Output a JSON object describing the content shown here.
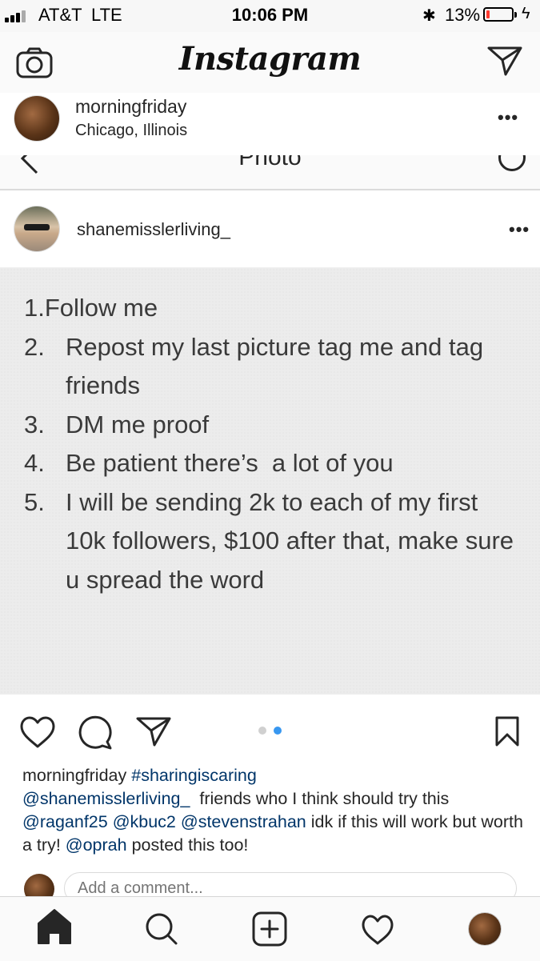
{
  "status_bar": {
    "carrier": "AT&T",
    "network": "LTE",
    "time": "10:06 PM",
    "battery_percent": "13%",
    "battery_level": 0.13,
    "icons": [
      "signal-icon",
      "bluetooth-icon",
      "battery-icon",
      "charging-icon"
    ]
  },
  "header": {
    "logo": "Instagram",
    "left_icon": "camera-icon",
    "right_icon": "direct-message-icon"
  },
  "post": {
    "username": "morningfriday",
    "location": "Chicago, Illinois",
    "more_label": "•••"
  },
  "photo_bar": {
    "title": "Photo"
  },
  "inner_post": {
    "username": "shanemisslerliving_",
    "more_label": "•••"
  },
  "post_image_text": {
    "items": [
      {
        "num": "1.",
        "text": "Follow me"
      },
      {
        "num": "2.",
        "text": "Repost my last picture tag me and tag friends"
      },
      {
        "num": "3.",
        "text": "DM me proof"
      },
      {
        "num": "4.",
        "text": "Be patient there’s  a lot of you"
      },
      {
        "num": "5.",
        "text": "I will be sending 2k to each of my first 10k followers, $100 after that, make sure u spread the word"
      }
    ]
  },
  "actions": {
    "icons": [
      "heart-icon",
      "comment-icon",
      "share-icon",
      "bookmark-icon"
    ],
    "carousel": {
      "total": 2,
      "active": 2
    }
  },
  "caption": {
    "username": "morningfriday",
    "hashtag": "#sharingiscaring",
    "mention_1": "@shanemisslerliving_",
    "text_1": "  friends who I think should try this ",
    "mention_2": "@raganf25",
    "mention_3": "@kbuc2",
    "mention_4": "@stevenstrahan",
    "text_2": " idk if this will work but worth a try! ",
    "mention_5": "@oprah",
    "text_3": " posted this too!"
  },
  "comment": {
    "placeholder": "Add a comment..."
  },
  "tab_bar": {
    "items": [
      "home-icon",
      "search-icon",
      "new-post-icon",
      "activity-icon",
      "profile-avatar"
    ]
  },
  "colors": {
    "link": "#003569",
    "carousel_active": "#3897f0",
    "carousel_inactive": "#d0d0d0",
    "battery_low": "#ff3b30"
  }
}
